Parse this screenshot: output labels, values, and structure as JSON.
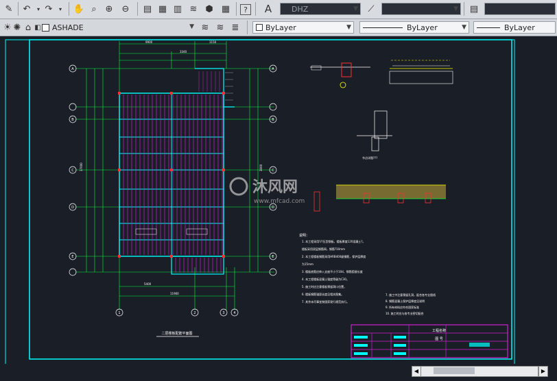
{
  "toolbar": {
    "text_style": "DHZ",
    "layer": "ASHADE",
    "color": "ByLayer",
    "linetype": "ByLayer",
    "lineweight": "ByLayer"
  },
  "drawing": {
    "grid_labels": {
      "A": "A",
      "B": "B",
      "C": "C",
      "D": "D",
      "E": "E",
      "one": "1",
      "two": "2",
      "three": "3",
      "four": "4"
    },
    "dims": {
      "top1": "9900",
      "top2": "1150",
      "top3": "3340",
      "left_total": "37000",
      "right_total": "3000",
      "bottom1": "5400",
      "bottom2": "11900"
    },
    "plan_title": "二层楼板配筋平面图",
    "note_title": "说明：",
    "notes": [
      "1. 本工程采用?/?压型钢板，楼板厚度120混凝土?。",
      "   楼板采用双层钢筋网，钢筋?10mm",
      "2. 本工程楼板钢筋采用HRB400级钢筋，保护层厚度",
      "   为15mm",
      "3. 楼板底筋应伸入支座不小于10d，钢筋搭接长度",
      "4. 本工程楼板混凝土强度等级为C30。",
      "5. 施工时应注意楼板预留洞口位置，",
      "6. 楼板钢筋锚固长度见相关图集。",
      "7. 其余未尽事宜按国家现行规范执行。"
    ],
    "notes2": [
      "7. 施工中注意预留孔洞，配合各专业图纸",
      "8. 钢筋混凝土保护层厚度见说明",
      "9. 所有材料应符合国家标准",
      "10. 施工时应与各专业密切配合"
    ],
    "detail_label": "节点详图???",
    "title_block": {
      "project": "工程名称",
      "drawing": "图 号"
    }
  },
  "watermark": {
    "brand": "沐风网",
    "url": "www.mfcad.com"
  }
}
